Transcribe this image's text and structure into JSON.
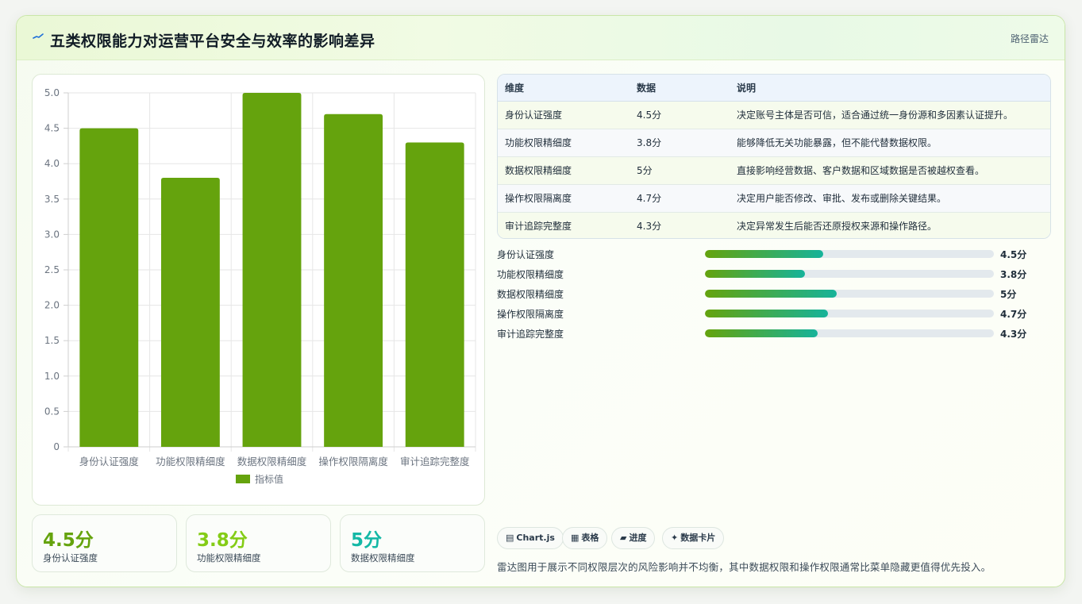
{
  "header": {
    "title": "五类权限能力对运营平台安全与效率的影响差异",
    "right_label": "路径雷达",
    "title_icon": "sparkline-icon"
  },
  "chart_data": {
    "type": "bar",
    "categories": [
      "身份认证强度",
      "功能权限精细度",
      "数据权限精细度",
      "操作权限隔离度",
      "审计追踪完整度"
    ],
    "series": [
      {
        "name": "指标值",
        "values": [
          4.5,
          3.8,
          5,
          4.7,
          4.3
        ],
        "color": "#65a30d"
      }
    ],
    "ylim": [
      0,
      5
    ],
    "yticks": [
      "0",
      "0.5",
      "1.0",
      "1.5",
      "2.0",
      "2.5",
      "3.0",
      "3.5",
      "4.0",
      "4.5",
      "5.0"
    ],
    "grid": true,
    "legend": "bottom"
  },
  "stats": [
    {
      "value": "4.5分",
      "label": "身份认证强度",
      "color": "#65a30d"
    },
    {
      "value": "3.8分",
      "label": "功能权限精细度",
      "color": "#84cc16"
    },
    {
      "value": "5分",
      "label": "数据权限精细度",
      "color": "#14b8a6"
    }
  ],
  "table": {
    "headers": [
      "维度",
      "数据",
      "说明"
    ],
    "rows": [
      [
        "身份认证强度",
        "4.5分",
        "决定账号主体是否可信，适合通过统一身份源和多因素认证提升。"
      ],
      [
        "功能权限精细度",
        "3.8分",
        "能够降低无关功能暴露，但不能代替数据权限。"
      ],
      [
        "数据权限精细度",
        "5分",
        "直接影响经营数据、客户数据和区域数据是否被越权查看。"
      ],
      [
        "操作权限隔离度",
        "4.7分",
        "决定用户能否修改、审批、发布或删除关键结果。"
      ],
      [
        "审计追踪完整度",
        "4.3分",
        "决定异常发生后能否还原授权来源和操作路径。"
      ]
    ]
  },
  "progress": [
    {
      "label": "身份认证强度",
      "value_text": "4.5分",
      "fraction": 0.41
    },
    {
      "label": "功能权限精细度",
      "value_text": "3.8分",
      "fraction": 0.345
    },
    {
      "label": "数据权限精细度",
      "value_text": "5分",
      "fraction": 0.455
    },
    {
      "label": "操作权限隔离度",
      "value_text": "4.7分",
      "fraction": 0.427
    },
    {
      "label": "审计追踪完整度",
      "value_text": "4.3分",
      "fraction": 0.39
    }
  ],
  "tags": [
    {
      "icon": "chart-icon",
      "glyph": "▤",
      "label": "Chart.js"
    },
    {
      "icon": "table-icon",
      "glyph": "▦",
      "label": "表格"
    },
    {
      "icon": "progress-icon",
      "glyph": "▰",
      "label": "进度"
    },
    {
      "icon": "card-icon",
      "glyph": "✦",
      "label": "数据卡片"
    }
  ],
  "note": "雷达图用于展示不同权限层次的风险影响并不均衡，其中数据权限和操作权限通常比菜单隐藏更值得优先投入。"
}
